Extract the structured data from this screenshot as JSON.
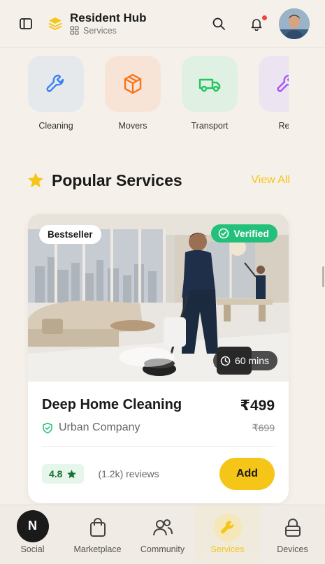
{
  "header": {
    "app_title": "Resident Hub",
    "breadcrumb": "Services",
    "sidebar_icon": "sidebar-toggle-icon",
    "logo_icon": "layers-icon",
    "search_icon": "search-icon",
    "bell_icon": "bell-icon",
    "notification_dot_color": "#ef4444"
  },
  "categories": [
    {
      "label": "Cleaning",
      "icon": "wrench-icon",
      "tile": "#e6e9ec",
      "color": "#3b82f6"
    },
    {
      "label": "Movers",
      "icon": "box-icon",
      "tile": "#f8e4d6",
      "color": "#f97316"
    },
    {
      "label": "Transport",
      "icon": "truck-icon",
      "tile": "#e0f1e4",
      "color": "#22c55e"
    },
    {
      "label": "Rep",
      "icon": "wrench-icon",
      "tile": "#ede4f2",
      "color": "#a855f7"
    }
  ],
  "section": {
    "title": "Popular Services",
    "view_all": "View All",
    "star_color": "#f5c518"
  },
  "card": {
    "badge_bestseller": "Bestseller",
    "badge_verified": "Verified",
    "duration": "60 mins",
    "name": "Deep Home Cleaning",
    "provider": "Urban Company",
    "price": "₹499",
    "old_price": "₹699",
    "rating": "4.8",
    "reviews": "(1.2k) reviews",
    "add_label": "Add"
  },
  "nav": {
    "social_initial": "N",
    "items": [
      {
        "label": "Social",
        "icon": "social-avatar"
      },
      {
        "label": "Marketplace",
        "icon": "shopping-bag-icon"
      },
      {
        "label": "Community",
        "icon": "users-icon"
      },
      {
        "label": "Services",
        "icon": "wrench-icon",
        "active": true
      },
      {
        "label": "Devices",
        "icon": "lock-icon"
      }
    ]
  },
  "colors": {
    "accent": "#f5c518",
    "success": "#22c07a",
    "background": "#f5f1ea"
  }
}
